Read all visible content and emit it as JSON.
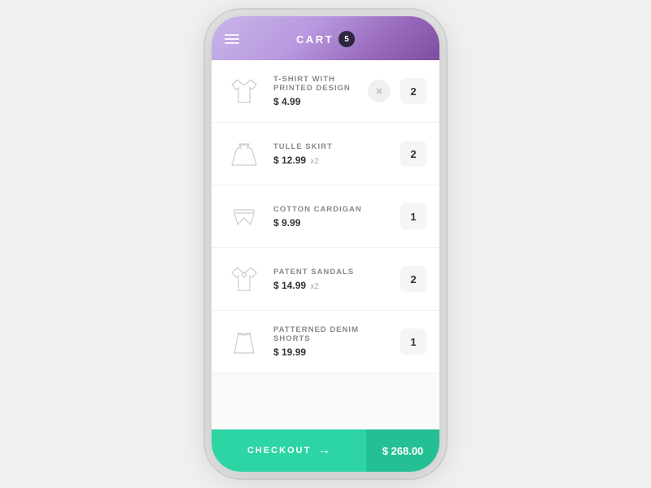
{
  "header": {
    "title": "CART",
    "badge": "5",
    "menu_label": "menu"
  },
  "cart": {
    "items": [
      {
        "id": "tshirt",
        "name": "T-SHIRT WITH PRINTED DESIGN",
        "price": "$ 4.99",
        "quantity": "2",
        "has_multiplier": false,
        "icon_type": "tshirt"
      },
      {
        "id": "tulle-skirt",
        "name": "TULLE SKIRT",
        "price": "$ 12.99",
        "quantity": "2",
        "has_multiplier": true,
        "multiplier": "x2",
        "icon_type": "dress"
      },
      {
        "id": "cotton-cardigan",
        "name": "COTTON CARDIGAN",
        "price": "$ 9.99",
        "quantity": "1",
        "has_multiplier": false,
        "icon_type": "shorts"
      },
      {
        "id": "patent-sandals",
        "name": "PATENT SANDALS",
        "price": "$ 14.99",
        "quantity": "2",
        "has_multiplier": true,
        "multiplier": "x2",
        "icon_type": "top"
      },
      {
        "id": "denim-shorts",
        "name": "PATTERNED DENIM SHORTS",
        "price": "$ 19.99",
        "quantity": "1",
        "has_multiplier": false,
        "icon_type": "skirt"
      }
    ]
  },
  "checkout": {
    "label": "CHECKOUT",
    "total": "$ 268.00",
    "arrow": "→"
  }
}
